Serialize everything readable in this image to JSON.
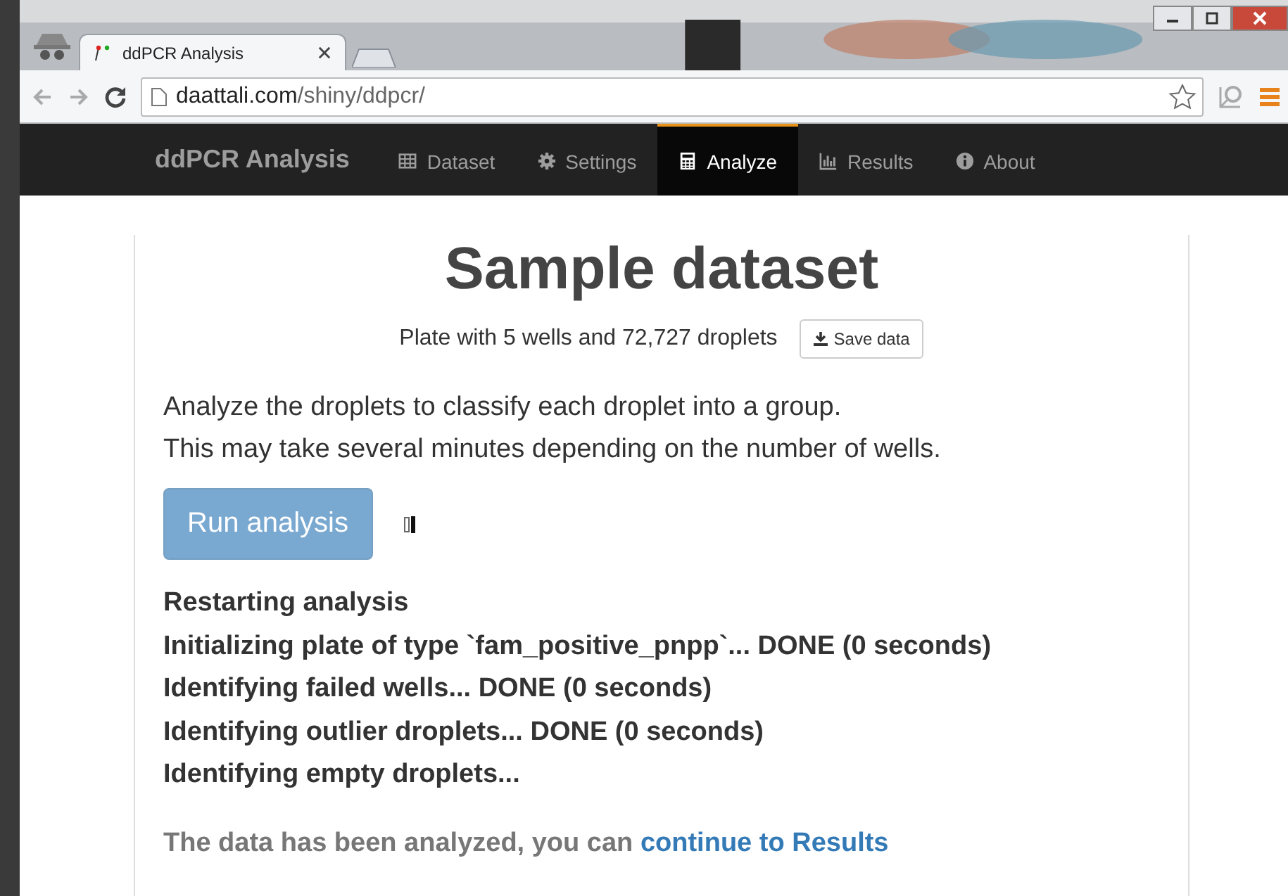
{
  "browser": {
    "tab_title": "ddPCR Analysis",
    "url_host": "daattali.com",
    "url_path": "/shiny/ddpcr/"
  },
  "navbar": {
    "brand": "ddPCR Analysis",
    "items": [
      {
        "label": "Dataset",
        "kind": "table",
        "selected": false
      },
      {
        "label": "Settings",
        "kind": "gear",
        "selected": false
      },
      {
        "label": "Analyze",
        "kind": "calculator",
        "selected": true
      },
      {
        "label": "Results",
        "kind": "chart",
        "selected": false
      },
      {
        "label": "About",
        "kind": "info",
        "selected": false
      }
    ]
  },
  "heading": "Sample dataset",
  "summary": "Plate with 5 wells and 72,727 droplets",
  "save_button": "Save data",
  "description": [
    "Analyze the droplets to classify each droplet into a group.",
    "This may take several minutes depending on the number of wells."
  ],
  "run_button": {
    "label": "Run analysis",
    "disabled": true
  },
  "log": [
    "Restarting analysis",
    "Initializing plate of type `fam_positive_pnpp`... DONE (0 seconds)",
    "Identifying failed wells... DONE (0 seconds)",
    "Identifying outlier droplets... DONE (0 seconds)",
    "Identifying empty droplets..."
  ],
  "done_text": "The data has been analyzed, you can",
  "done_link": "continue to Results"
}
